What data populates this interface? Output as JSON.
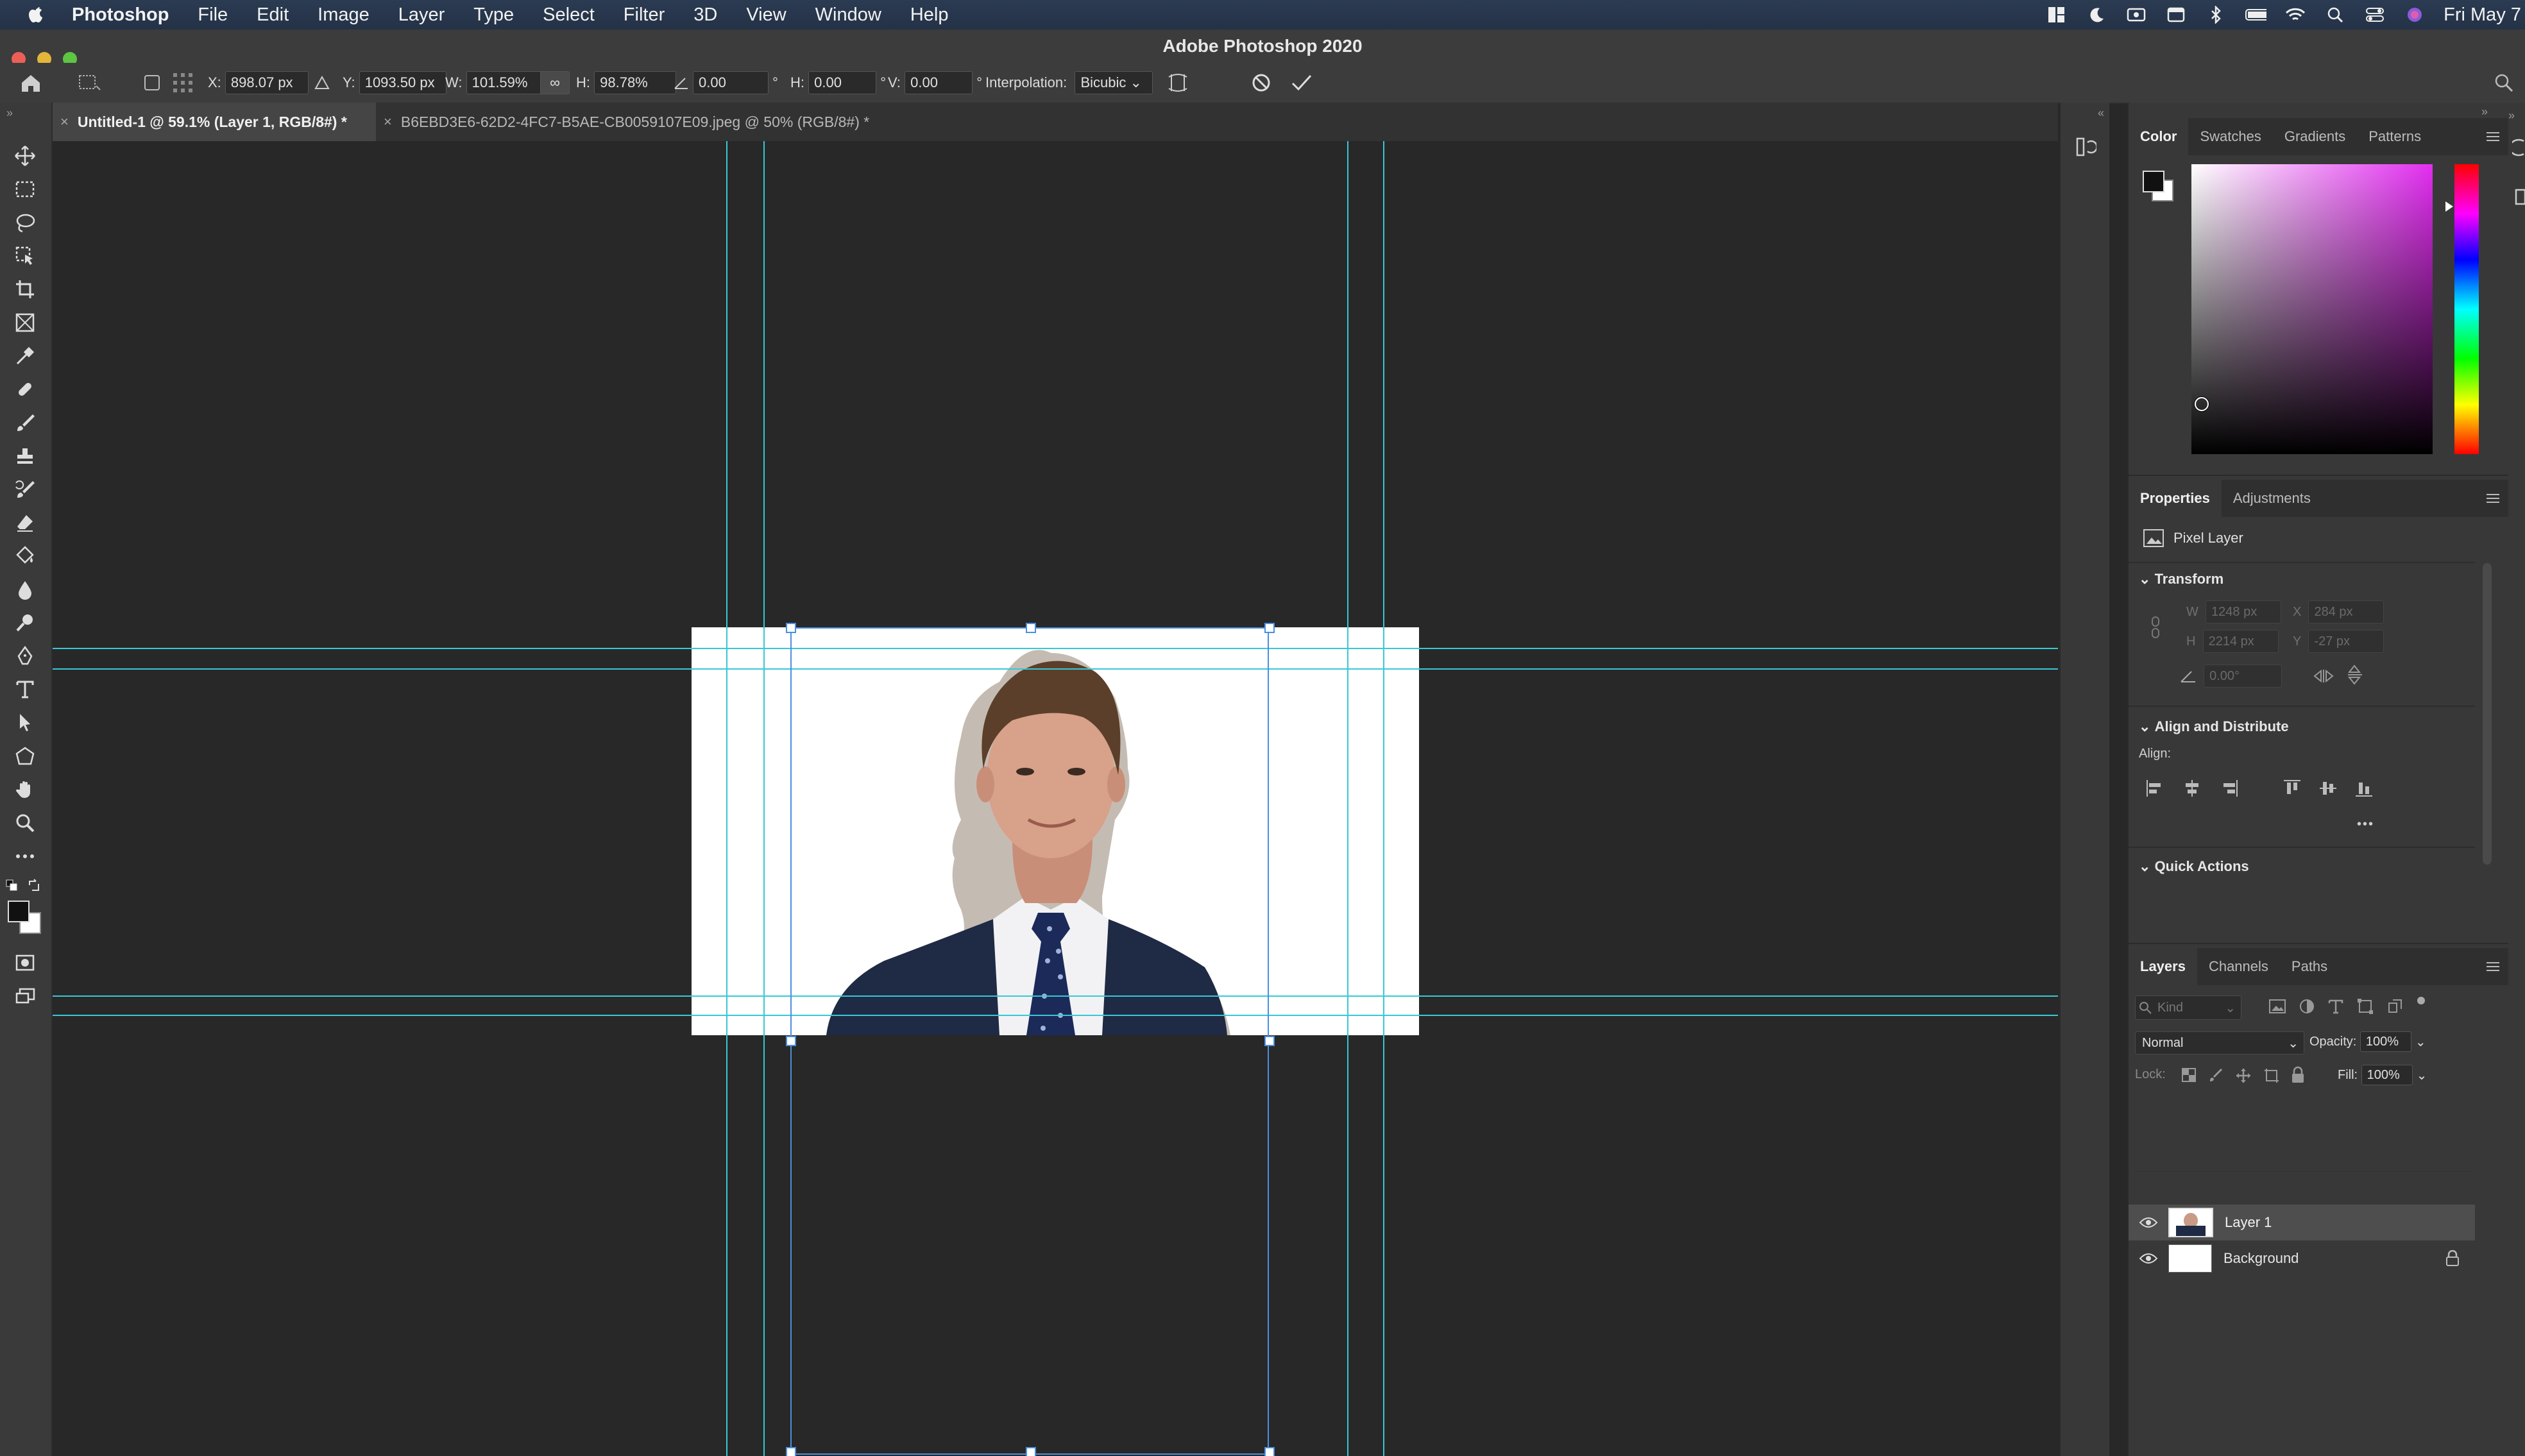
{
  "menubar": {
    "items": [
      "Photoshop",
      "File",
      "Edit",
      "Image",
      "Layer",
      "Type",
      "Select",
      "Filter",
      "3D",
      "View",
      "Window",
      "Help"
    ],
    "clock": "Fri May 7"
  },
  "window": {
    "title": "Adobe Photoshop 2020"
  },
  "options": {
    "x_label": "X:",
    "x_value": "898.07 px",
    "y_label": "Y:",
    "y_value": "1093.50 px",
    "w_label": "W:",
    "w_value": "101.59%",
    "h_label": "H:",
    "h_value": "98.78%",
    "angle_value": "0.00",
    "hskew_label": "H:",
    "hskew_value": "0.00",
    "vskew_label": "V:",
    "vskew_value": "0.00",
    "deg": "°",
    "interp_label": "Interpolation:",
    "interp_value": "Bicubic"
  },
  "tabs": [
    {
      "label": "Untitled-1 @ 59.1% (Layer 1, RGB/8#) *",
      "active": true
    },
    {
      "label": "B6EBD3E6-62D2-4FC7-B5AE-CB0059107E09.jpeg @ 50% (RGB/8#) *",
      "active": false
    }
  ],
  "color_panel": {
    "tabs": [
      "Color",
      "Swatches",
      "Gradients",
      "Patterns"
    ]
  },
  "properties_panel": {
    "tabs": [
      "Properties",
      "Adjustments"
    ],
    "layer_type": "Pixel Layer",
    "transform_title": "Transform",
    "w_label": "W",
    "w_value": "1248 px",
    "x_label": "X",
    "x_value": "284 px",
    "h_label": "H",
    "h_value": "2214 px",
    "y_label": "Y",
    "y_value": "-27 px",
    "angle_value": "0.00°",
    "align_title": "Align and Distribute",
    "align_label": "Align:",
    "more": "•••",
    "quick_actions": "Quick Actions"
  },
  "layers_panel": {
    "tabs": [
      "Layers",
      "Channels",
      "Paths"
    ],
    "filter_placeholder": "Kind",
    "blend_mode": "Normal",
    "opacity_label": "Opacity:",
    "opacity_value": "100%",
    "lock_label": "Lock:",
    "fill_label": "Fill:",
    "fill_value": "100%",
    "layers": [
      {
        "name": "Layer 1",
        "selected": true
      },
      {
        "name": "Background",
        "selected": false,
        "locked": true
      }
    ]
  },
  "colors": {
    "accent_guides": "#38c8d6",
    "selection": "#4a8fe0",
    "panel_bg": "#383838"
  }
}
